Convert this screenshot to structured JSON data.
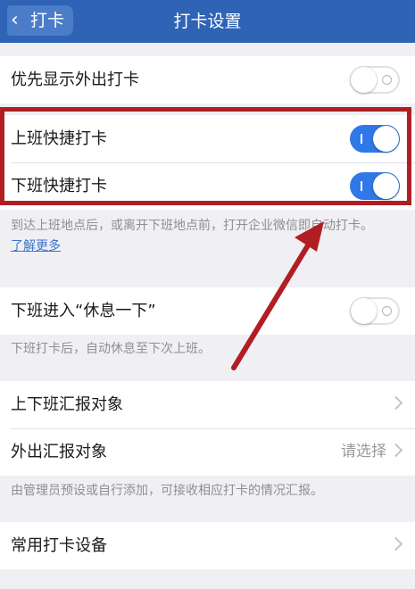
{
  "nav": {
    "back_label": "打卡",
    "title": "打卡设置"
  },
  "settings": {
    "priority_outside": {
      "label": "优先显示外出打卡",
      "enabled": false
    },
    "quick_clock_in": {
      "label": "上班快捷打卡",
      "enabled": true
    },
    "quick_clock_out": {
      "label": "下班快捷打卡",
      "enabled": true
    },
    "quick_note": "到达上班地点后，或离开下班地点前，打开企业微信即自动打卡。",
    "learn_more": "了解更多",
    "rest_mode": {
      "label": "下班进入“休息一下”",
      "enabled": false
    },
    "rest_note": "下班打卡后，自动休息至下次上班。",
    "report_target": {
      "label": "上下班汇报对象"
    },
    "outside_report_target": {
      "label": "外出汇报对象",
      "value": "请选择"
    },
    "report_note": "由管理员预设或自行添加，可接收相应打卡的情况汇报。",
    "common_devices": {
      "label": "常用打卡设备"
    }
  },
  "colors": {
    "nav_bar": "#2f63b6",
    "toggle_on": "#2f78e8",
    "annotation": "#b01e24",
    "link": "#3b74c9"
  }
}
